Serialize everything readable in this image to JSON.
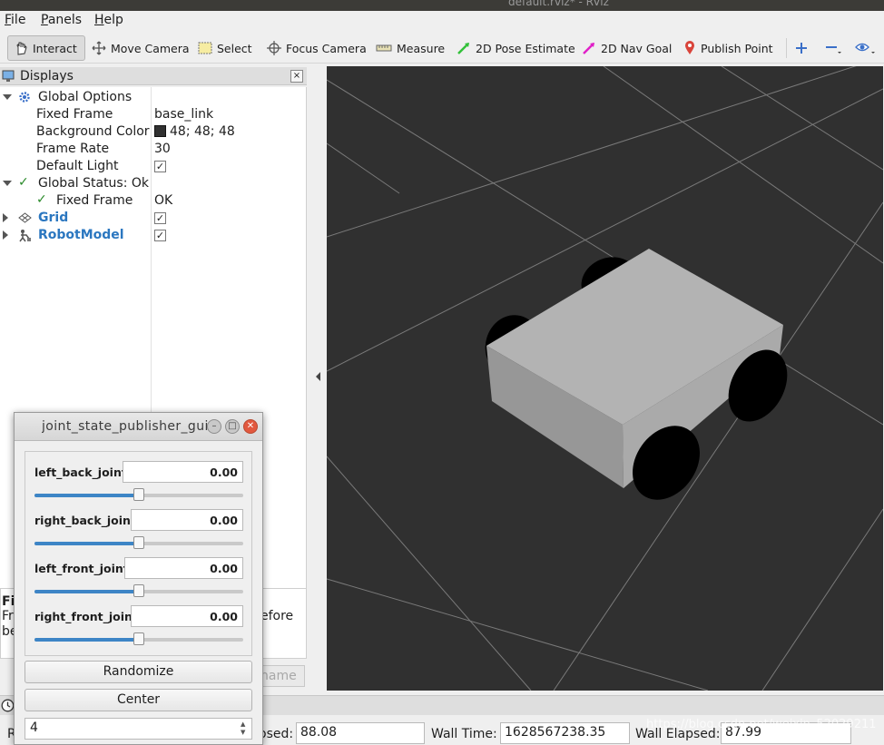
{
  "window": {
    "title_fragment": "default.rviz* - RViz"
  },
  "menubar": {
    "items": [
      {
        "label": "File",
        "underline": "F",
        "rest": "ile"
      },
      {
        "label": "Panels",
        "underline": "P",
        "rest": "anels"
      },
      {
        "label": "Help",
        "underline": "H",
        "rest": "elp"
      }
    ]
  },
  "toolbar": {
    "interact": "Interact",
    "move_camera": "Move Camera",
    "select": "Select",
    "focus_camera": "Focus Camera",
    "measure": "Measure",
    "pose_estimate": "2D Pose Estimate",
    "nav_goal": "2D Nav Goal",
    "publish_point": "Publish Point"
  },
  "displays": {
    "title": "Displays",
    "close": "×",
    "global_options": "Global Options",
    "fixed_frame_label": "Fixed Frame",
    "fixed_frame_value": "base_link",
    "bg_color_label": "Background Color",
    "bg_color_value": "48; 48; 48",
    "frame_rate_label": "Frame Rate",
    "frame_rate_value": "30",
    "default_light_label": "Default Light",
    "default_light_checked": "✓",
    "global_status": "Global Status: Ok",
    "status_fixed_frame_label": "Fixed Frame",
    "status_fixed_frame_value": "OK",
    "grid": "Grid",
    "grid_checked": "✓",
    "robot_model": "RobotModel",
    "robot_model_checked": "✓"
  },
  "description": {
    "title_fragment": "Fix",
    "line1_fragment": "Fra",
    "line2_fragment": "be",
    "right_fragment": "efore"
  },
  "rename_button": "name",
  "time": {
    "ros_elapsed_label": "osed:",
    "ros_elapsed_value": "88.08",
    "wall_time_label": "Wall Time:",
    "wall_time_value": "1628567238.35",
    "wall_elapsed_label": "Wall Elapsed:",
    "wall_elapsed_value": "87.99",
    "left_fragment": "R",
    "left_fragment2": "b"
  },
  "watermark": "https://blog.csdn.net/weixin_52029211",
  "joint_gui": {
    "title": "joint_state_publisher_gui",
    "joints": [
      {
        "name": "left_back_joint",
        "value": "0.00",
        "position": 0.5
      },
      {
        "name": "right_back_joint",
        "value": "0.00",
        "position": 0.5
      },
      {
        "name": "left_front_joint",
        "value": "0.00",
        "position": 0.5
      },
      {
        "name": "right_front_joint",
        "value": "0.00",
        "position": 0.5
      }
    ],
    "randomize": "Randomize",
    "center": "Center",
    "spin_value": "4"
  },
  "colors": {
    "viewport_bg": "#303030",
    "link_blue": "#2b77c0",
    "slider_fill": "#3d85c6",
    "robot_body": "#b3b3b3",
    "wheels": "#000000"
  }
}
